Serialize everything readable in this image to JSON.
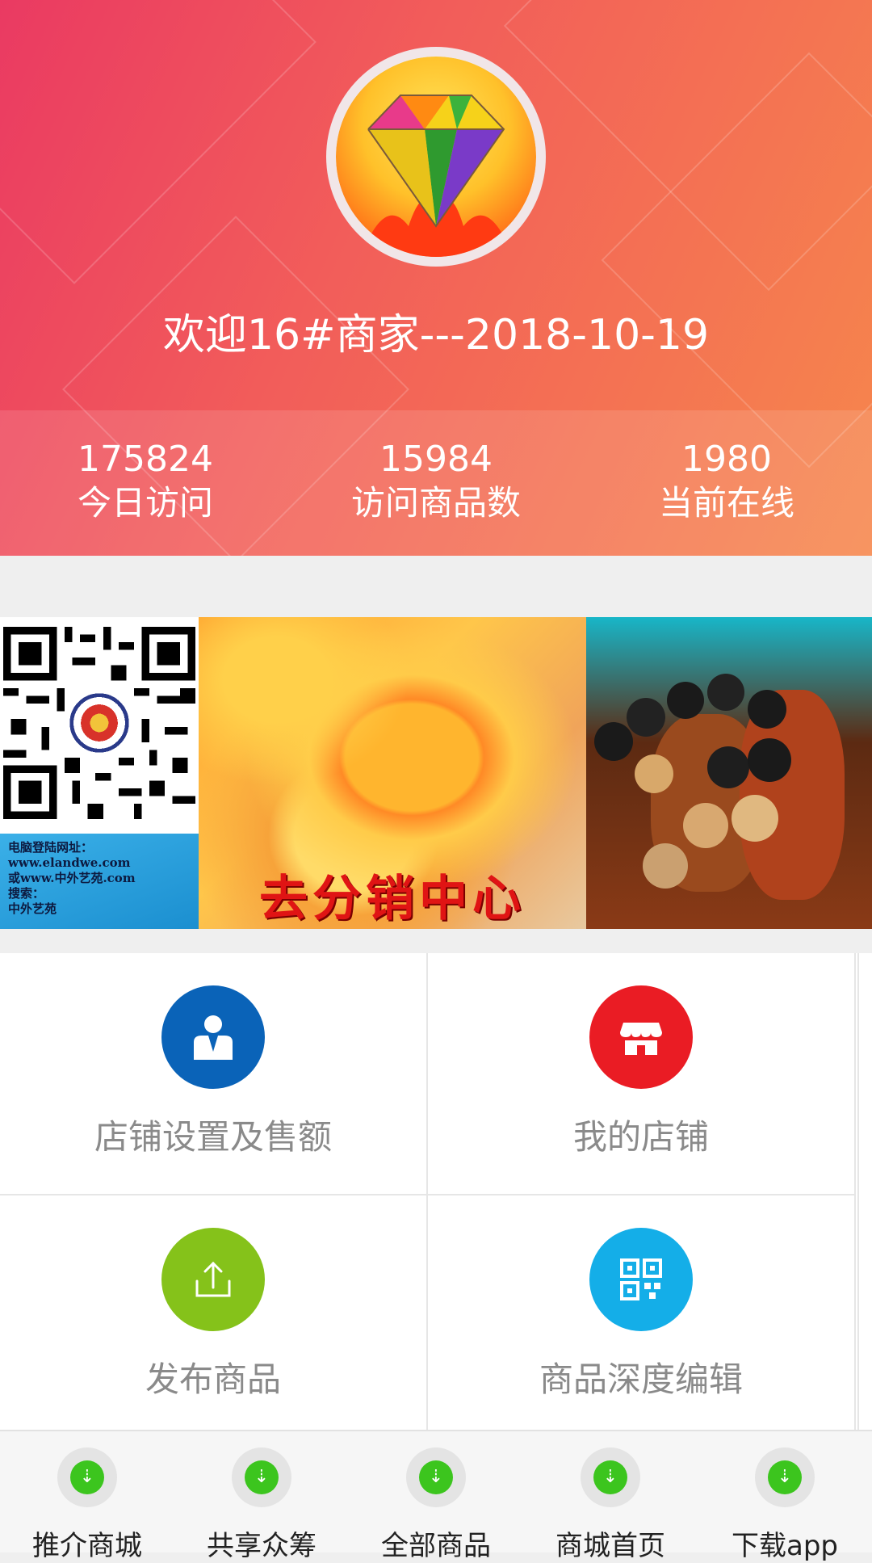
{
  "header": {
    "welcome": "欢迎16#商家---2018-10-19",
    "stats": [
      {
        "value": "175824",
        "label": "今日访问"
      },
      {
        "value": "15984",
        "label": "访问商品数"
      },
      {
        "value": "1980",
        "label": "当前在线"
      }
    ]
  },
  "banner": {
    "qr_lines": [
      "电脑登陆网址：",
      "www.elandwe.com",
      "或www.中外艺苑.com",
      "搜索：",
      "中外艺苑"
    ],
    "center_title": "去分销中心"
  },
  "menu": [
    {
      "label": "店铺设置及售额",
      "icon": "user-tie-icon",
      "color": "#0a63b8"
    },
    {
      "label": "我的店铺",
      "icon": "store-icon",
      "color": "#ea1c24"
    },
    {
      "label": "发布商品",
      "icon": "upload-icon",
      "color": "#85c21a"
    },
    {
      "label": "商品深度编辑",
      "icon": "qr-code-icon",
      "color": "#14aee8"
    }
  ],
  "tabbar": [
    {
      "label": "推介商城",
      "icon": "download-icon"
    },
    {
      "label": "共享众筹",
      "icon": "download-icon"
    },
    {
      "label": "全部商品",
      "icon": "download-icon"
    },
    {
      "label": "商城首页",
      "icon": "download-icon"
    },
    {
      "label": "下载app",
      "icon": "download-icon"
    }
  ]
}
